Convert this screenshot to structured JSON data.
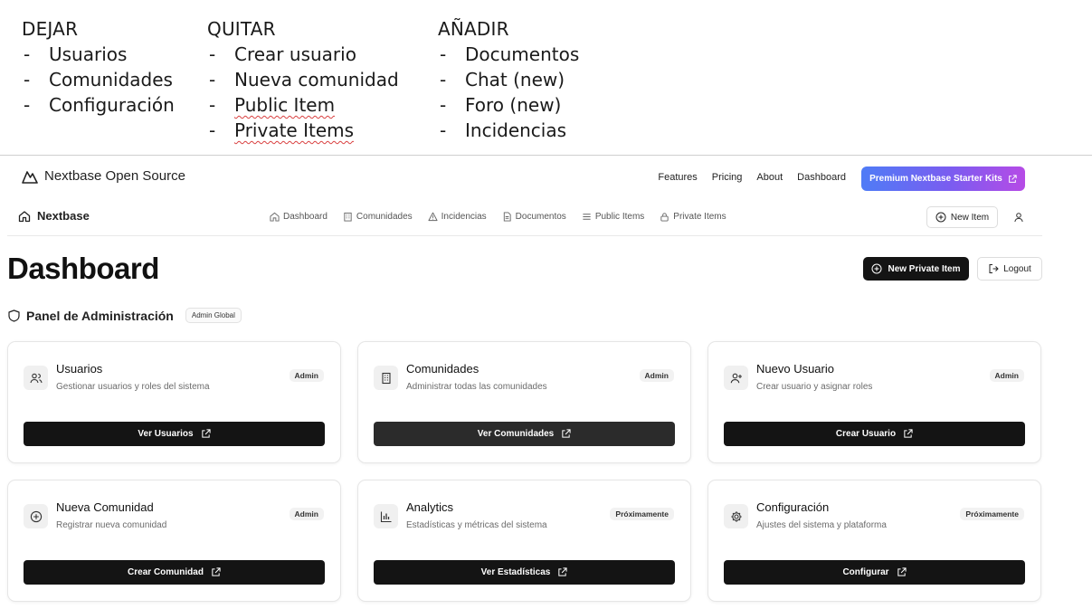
{
  "notes": {
    "dejar": {
      "heading": "DEJAR",
      "items": [
        "Usuarios",
        "Comunidades",
        "Configuración"
      ]
    },
    "quitar": {
      "heading": "QUITAR",
      "items": [
        "Crear usuario",
        "Nueva comunidad",
        "Public Item",
        "Private Items"
      ]
    },
    "anadir": {
      "heading": "AÑADIR",
      "items": [
        "Documentos",
        "Chat (new)",
        "Foro (new)",
        "Incidencias"
      ]
    }
  },
  "topnav": {
    "brand": "Nextbase Open Source",
    "links": [
      "Features",
      "Pricing",
      "About",
      "Dashboard"
    ],
    "premium_label": "Premium Nextbase Starter Kits"
  },
  "appnav": {
    "brand": "Nextbase",
    "links": [
      {
        "label": "Dashboard",
        "icon": "home-icon"
      },
      {
        "label": "Comunidades",
        "icon": "building-icon"
      },
      {
        "label": "Incidencias",
        "icon": "warning-icon"
      },
      {
        "label": "Documentos",
        "icon": "document-icon"
      },
      {
        "label": "Public Items",
        "icon": "list-icon"
      },
      {
        "label": "Private Items",
        "icon": "lock-icon"
      }
    ],
    "new_item_label": "New Item"
  },
  "header": {
    "title": "Dashboard",
    "new_private_label": "New Private Item",
    "logout_label": "Logout"
  },
  "panel": {
    "title": "Panel de Administración",
    "badge": "Admin Global"
  },
  "cards": [
    {
      "title": "Usuarios",
      "desc": "Gestionar usuarios y roles del sistema",
      "badge": "Admin",
      "button": "Ver Usuarios",
      "icon": "users-icon"
    },
    {
      "title": "Comunidades",
      "desc": "Administrar todas las comunidades",
      "badge": "Admin",
      "button": "Ver Comunidades",
      "icon": "building-icon"
    },
    {
      "title": "Nuevo Usuario",
      "desc": "Crear usuario y asignar roles",
      "badge": "Admin",
      "button": "Crear Usuario",
      "icon": "user-plus-icon"
    },
    {
      "title": "Nueva Comunidad",
      "desc": "Registrar nueva comunidad",
      "badge": "Admin",
      "button": "Crear Comunidad",
      "icon": "plus-circle-icon"
    },
    {
      "title": "Analytics",
      "desc": "Estadísticas y métricas del sistema",
      "badge": "Próximamente",
      "button": "Ver Estadísticas",
      "icon": "bar-chart-icon"
    },
    {
      "title": "Configuración",
      "desc": "Ajustes del sistema y plataforma",
      "badge": "Próximamente",
      "button": "Configurar",
      "icon": "gear-icon"
    }
  ],
  "colors": {
    "primary_button": "#141414",
    "premium_gradient_start": "#4f7cf6",
    "premium_gradient_end": "#b64be6",
    "spellcheck_underline": "#d94040"
  }
}
